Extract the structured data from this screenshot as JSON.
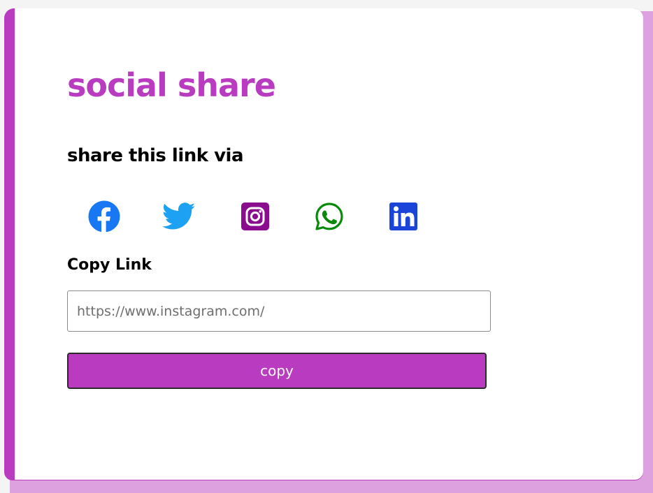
{
  "card": {
    "title": "social share",
    "share_heading": "share this link via",
    "copy_heading": "Copy Link"
  },
  "share_icons": [
    {
      "name": "facebook-icon",
      "color": "#1877f2"
    },
    {
      "name": "twitter-icon",
      "color": "#1da1f2"
    },
    {
      "name": "instagram-icon",
      "color": "#8b0d8f"
    },
    {
      "name": "whatsapp-icon",
      "color": "#0a8a0a"
    },
    {
      "name": "linkedin-icon",
      "color": "#1a45d8"
    }
  ],
  "link_input": {
    "value": "",
    "placeholder": "https://www.instagram.com/"
  },
  "copy_button": {
    "label": "copy"
  },
  "colors": {
    "accent": "#b93bbf",
    "background_layer": "#dea1df",
    "card": "#ffffff"
  }
}
